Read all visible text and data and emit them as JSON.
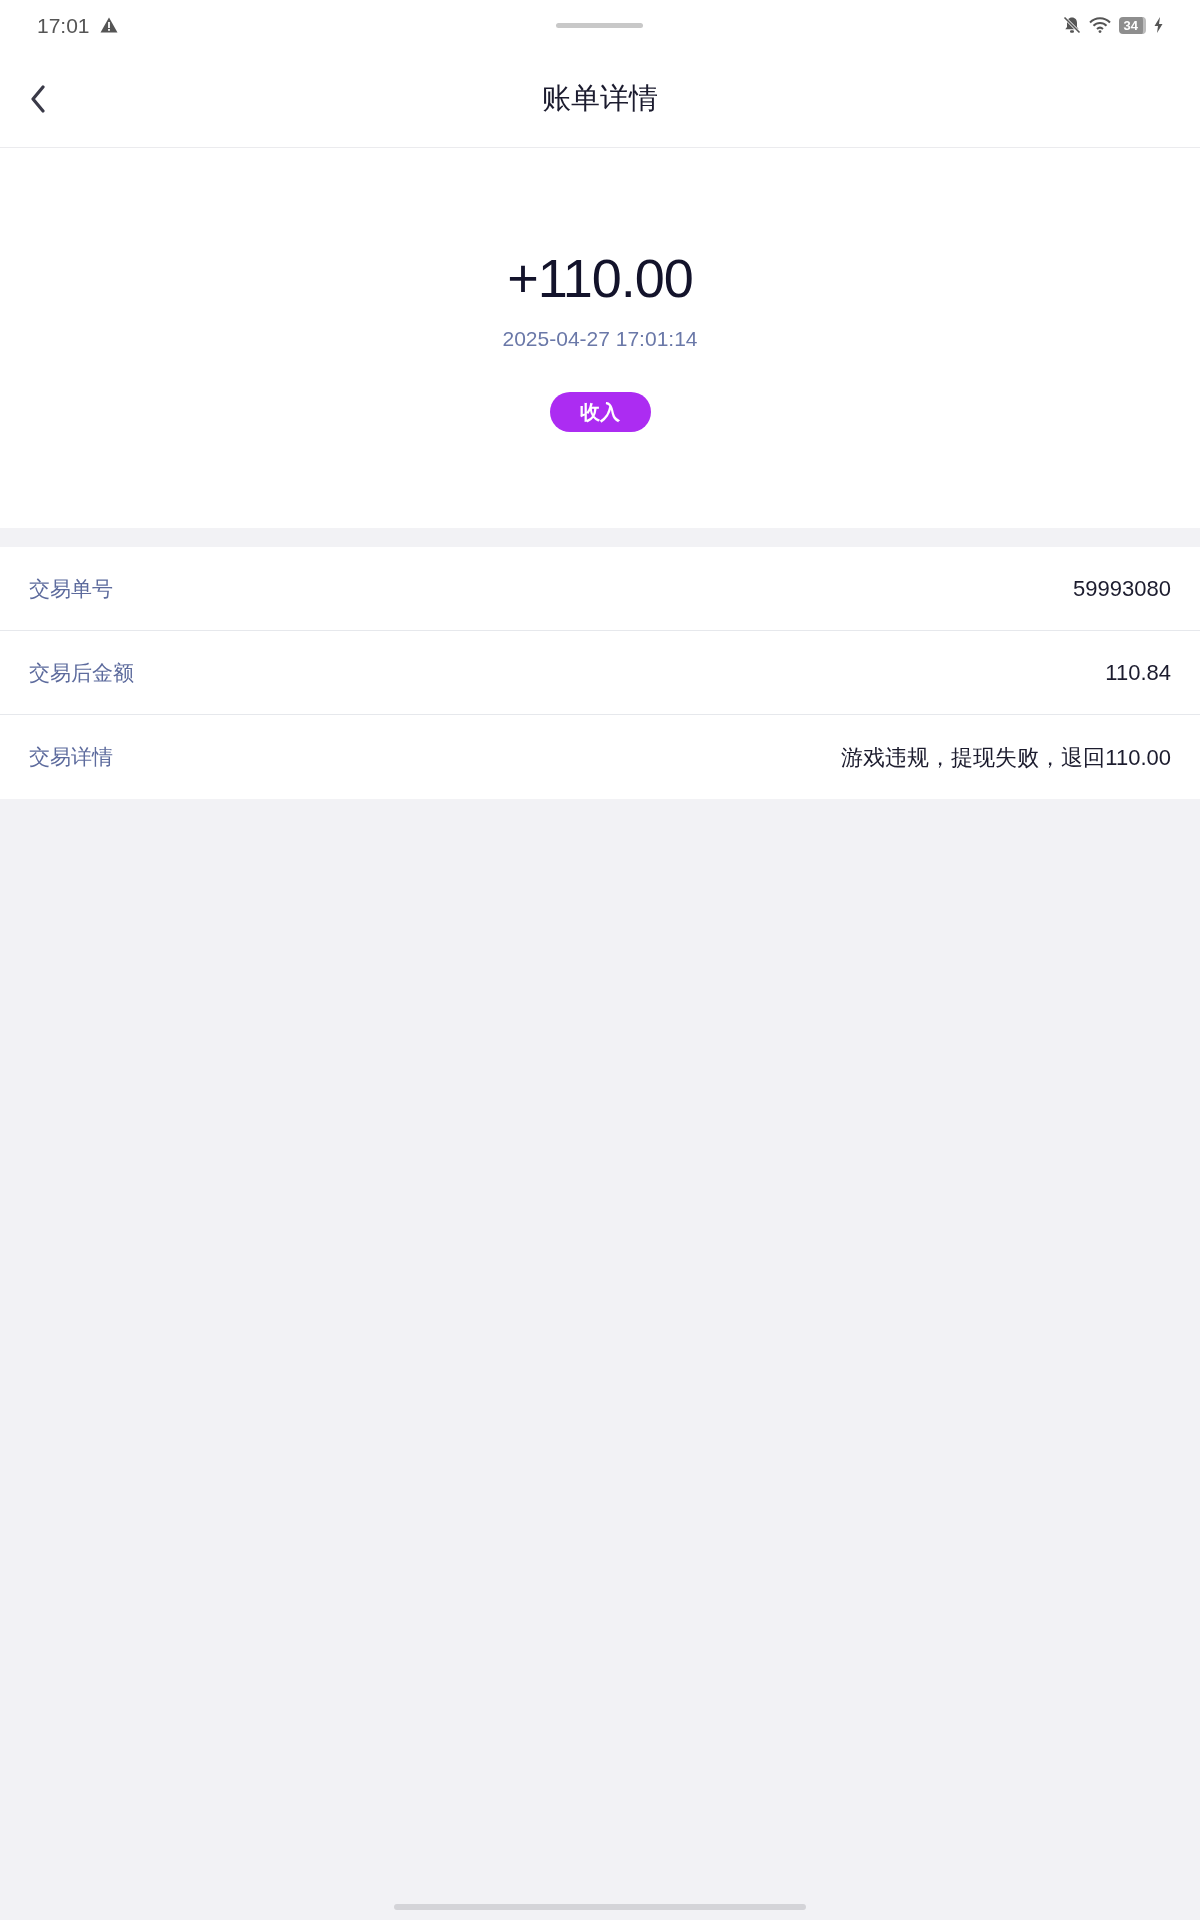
{
  "status_bar": {
    "time": "17:01",
    "battery": "34"
  },
  "header": {
    "title": "账单详情"
  },
  "summary": {
    "amount": "+110.00",
    "time": "2025-04-27 17:01:14",
    "type_badge": "收入"
  },
  "details": [
    {
      "label": "交易单号",
      "value": "59993080"
    },
    {
      "label": "交易后金额",
      "value": "110.84"
    },
    {
      "label": "交易详情",
      "value": "游戏违规，提现失败，退回110.00"
    }
  ]
}
